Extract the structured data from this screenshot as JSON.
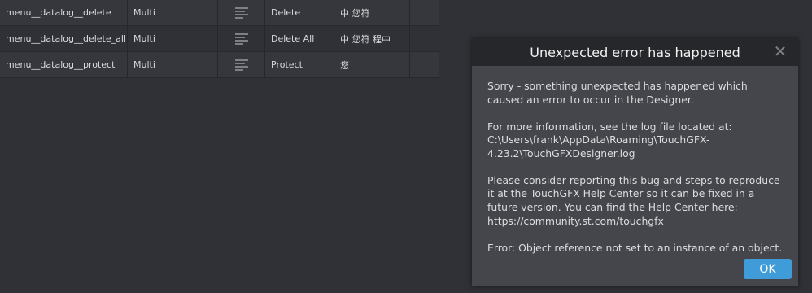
{
  "table": {
    "rows": [
      {
        "id": "menu__datalog__delete",
        "type": "Multi",
        "alignment_icon": "align-left-icon",
        "en": "Delete",
        "zh": "中 您符"
      },
      {
        "id": "menu__datalog__delete_all",
        "type": "Multi",
        "alignment_icon": "align-left-icon",
        "en": "Delete All",
        "zh": "中 您符 程中"
      },
      {
        "id": "menu__datalog__protect",
        "type": "Multi",
        "alignment_icon": "align-left-icon",
        "en": "Protect",
        "zh": "您"
      }
    ]
  },
  "dialog": {
    "title": "Unexpected error has happened",
    "close_icon": "close-icon",
    "paragraphs": [
      "Sorry - something unexpected has happened which caused an error to occur in the Designer.",
      "For more information, see the log file located at: C:\\Users\\frank\\AppData\\Roaming\\TouchGFX-4.23.2\\TouchGFXDesigner.log",
      "Please consider reporting this bug and steps to reproduce it at the TouchGFX Help Center so it can be fixed in a future version. You can find the Help Center here: https://community.st.com/touchgfx",
      "Error: Object reference not set to an instance of an object."
    ],
    "ok_label": "OK",
    "accent": "#3f9cd9"
  }
}
